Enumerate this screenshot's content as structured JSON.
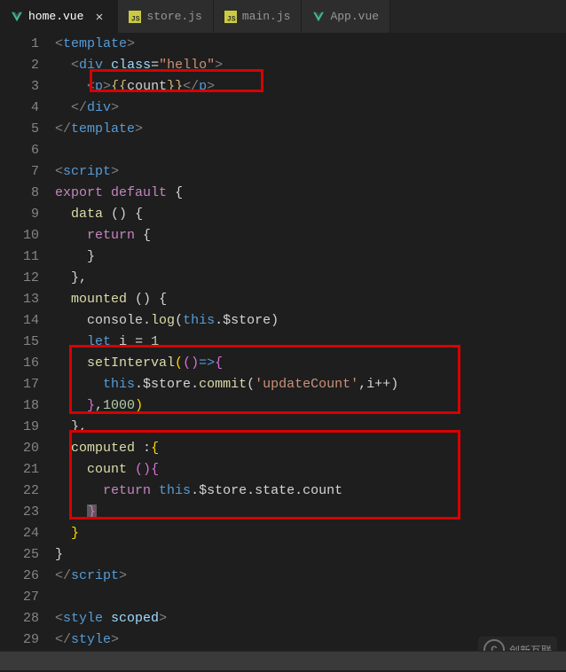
{
  "tabs": [
    {
      "label": "home.vue",
      "icon": "vue",
      "active": true,
      "closable": true
    },
    {
      "label": "store.js",
      "icon": "js",
      "active": false,
      "closable": false
    },
    {
      "label": "main.js",
      "icon": "js",
      "active": false,
      "closable": false
    },
    {
      "label": "App.vue",
      "icon": "vue",
      "active": false,
      "closable": false
    }
  ],
  "code": {
    "l1": {
      "t_open": "<",
      "tag": "template",
      "t_close": ">"
    },
    "l2": {
      "t_open": "<",
      "tag": "div",
      "sp": " ",
      "attr": "class",
      "eq": "=",
      "q1": "\"",
      "str": "hello",
      "q2": "\"",
      "t_close": ">"
    },
    "l3": {
      "open1": "<",
      "tag_p": "p",
      "close1": ">",
      "lb": "{{",
      "var": "count",
      "rb": "}}",
      "open2": "</",
      "close2": ">"
    },
    "l4": {
      "t_open": "</",
      "tag": "div",
      "t_close": ">"
    },
    "l5": {
      "t_open": "</",
      "tag": "template",
      "t_close": ">"
    },
    "l7": {
      "t_open": "<",
      "tag": "script",
      "t_close": ">"
    },
    "l8": {
      "kw1": "export",
      "sp1": " ",
      "kw2": "default",
      "sp2": " ",
      "brace": "{"
    },
    "l9": {
      "fn": "data",
      "sp": " ",
      "paren": "()",
      "sp2": " ",
      "brace": "{"
    },
    "l10": {
      "kw": "return",
      "sp": " ",
      "brace": "{"
    },
    "l11": {
      "brace": "}"
    },
    "l12": {
      "brace": "}",
      "comma": ","
    },
    "l13": {
      "fn": "mounted",
      "sp": " ",
      "paren": "()",
      "sp2": " ",
      "brace": "{"
    },
    "l14": {
      "obj": "console",
      "dot": ".",
      "fn": "log",
      "po": "(",
      "this": "this",
      "dot2": ".",
      "prop": "$store",
      "pc": ")"
    },
    "l15": {
      "kw": "let",
      "sp": " ",
      "var": "i",
      "sp2": " ",
      "eq": "=",
      "sp3": " ",
      "num": "1"
    },
    "l16": {
      "fn": "setInterval",
      "po": "(",
      "paren": "()",
      "arrow": "=>",
      "brace": "{"
    },
    "l17": {
      "this": "this",
      "dot1": ".",
      "prop1": "$store",
      "dot2": ".",
      "fn": "commit",
      "po": "(",
      "str": "'updateCount'",
      "comma": ",",
      "var": "i",
      "inc": "++",
      "pc": ")"
    },
    "l18": {
      "brace": "}",
      "comma": ",",
      "num": "1000",
      "pc": ")"
    },
    "l19": {
      "brace": "}",
      "comma": ","
    },
    "l20": {
      "fn": "computed",
      "sp": " ",
      "colon": ":",
      "brace": "{"
    },
    "l21": {
      "fn": "count",
      "sp": " ",
      "paren": "()",
      "brace": "{"
    },
    "l22": {
      "kw": "return",
      "sp": " ",
      "this": "this",
      "dot1": ".",
      "prop1": "$store",
      "dot2": ".",
      "prop2": "state",
      "dot3": ".",
      "prop3": "count"
    },
    "l23": {
      "brace": "}"
    },
    "l24": {
      "brace": "}"
    },
    "l25": {
      "brace": "}"
    },
    "l26": {
      "t_open": "</",
      "tag": "script",
      "t_close": ">"
    },
    "l28": {
      "t_open": "<",
      "tag": "style",
      "sp": " ",
      "attr": "scoped",
      "t_close": ">"
    },
    "l29": {
      "t_open": "</",
      "tag": "style",
      "t_close": ">"
    }
  },
  "watermark": {
    "icon": "C",
    "text": "创新互联"
  },
  "line_count": 30
}
